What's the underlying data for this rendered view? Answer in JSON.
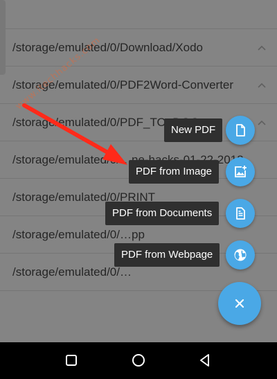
{
  "folders": [
    {
      "path": ""
    },
    {
      "path": "/storage/emulated/0/Download/Xodo"
    },
    {
      "path": "/storage/emulated/0/PDF2Word-Converter"
    },
    {
      "path": "/storage/emulated/0/PDF_TO_DOC"
    },
    {
      "path": "/storage/emulated/0/…ne-hacks-01-22-2018"
    },
    {
      "path": "/storage/emulated/0/PRINT"
    },
    {
      "path": "/storage/emulated/0/…pp"
    },
    {
      "path": "/storage/emulated/0/…"
    }
  ],
  "watermark": "www.itechhacks.com",
  "speed_dial": {
    "new_pdf": "New PDF",
    "from_image": "PDF from Image",
    "from_documents": "PDF from Documents",
    "from_webpage": "PDF from Webpage"
  },
  "colors": {
    "fab": "#4aa8e6",
    "label_bg": "#2f2f2f",
    "arrow": "#ff2a1a"
  },
  "icons": {
    "new_pdf": "file-icon",
    "from_image": "add-image-icon",
    "from_documents": "document-icon",
    "from_webpage": "globe-icon",
    "main": "close-icon"
  }
}
